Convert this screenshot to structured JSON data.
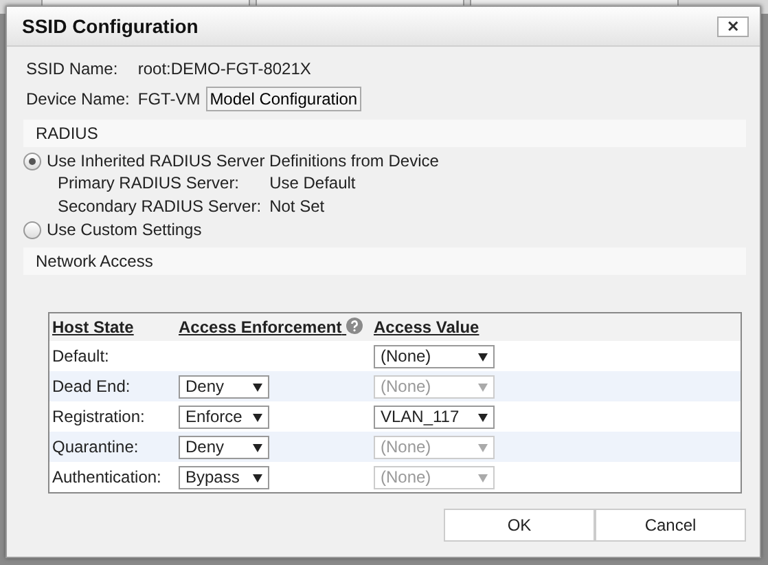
{
  "dialog": {
    "title": "SSID Configuration",
    "close": "✕"
  },
  "info": [
    {
      "label": "SSID Name:",
      "value": "root:DEMO-FGT-8021X"
    },
    {
      "label": "Device Name:",
      "value": "FGT-VM"
    }
  ],
  "model_button": "Model Configuration",
  "radius": {
    "heading": "RADIUS",
    "options": [
      {
        "label": "Use Inherited RADIUS Server Definitions from Device",
        "selected": true
      },
      {
        "label": "Use Custom Settings",
        "selected": false
      }
    ],
    "servers": [
      {
        "label": "Primary RADIUS Server:",
        "value": "Use Default"
      },
      {
        "label": "Secondary RADIUS Server:",
        "value": "Not Set"
      }
    ]
  },
  "network_access": {
    "heading": "Network Access",
    "columns": [
      "Host State",
      "Access Enforcement",
      "Access Value"
    ],
    "rows": [
      {
        "state": "Default:",
        "value": {
          "text": "(None)",
          "disabled": false
        }
      },
      {
        "state": "Dead End:",
        "enforcement": "Deny",
        "value": {
          "text": "(None)",
          "disabled": true
        }
      },
      {
        "state": "Registration:",
        "enforcement": "Enforce",
        "value": {
          "text": "VLAN_117",
          "disabled": false
        }
      },
      {
        "state": "Quarantine:",
        "enforcement": "Deny",
        "value": {
          "text": "(None)",
          "disabled": true
        }
      },
      {
        "state": "Authentication:",
        "enforcement": "Bypass",
        "value": {
          "text": "(None)",
          "disabled": true
        }
      }
    ]
  },
  "buttons": [
    "OK",
    "Cancel"
  ]
}
